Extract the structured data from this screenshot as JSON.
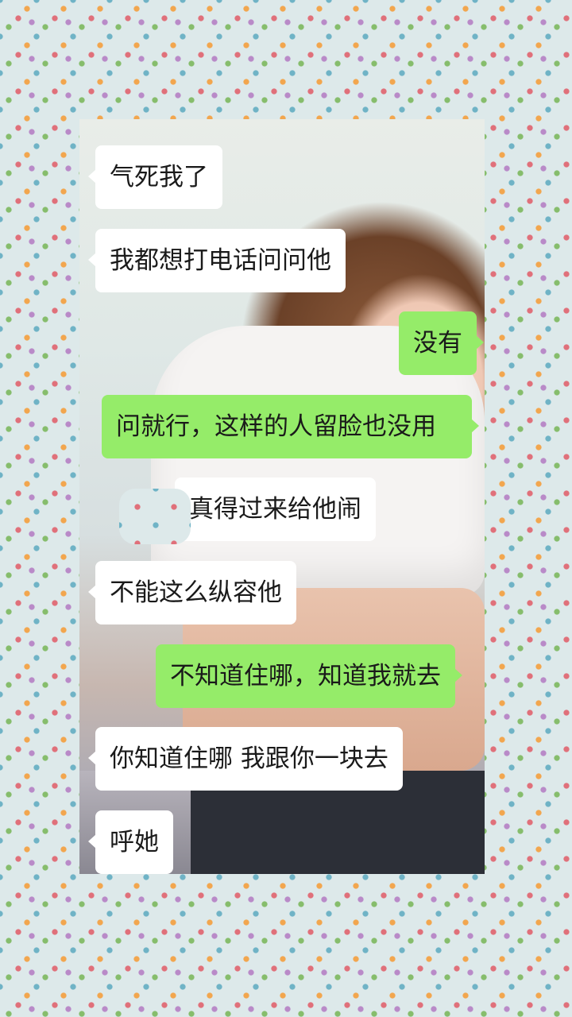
{
  "chat": {
    "messages": [
      {
        "side": "in",
        "text": "气死我了"
      },
      {
        "side": "in",
        "text": "我都想打电话问问他"
      },
      {
        "side": "out",
        "text": "没有"
      },
      {
        "side": "out",
        "text": "问就行，这样的人留脸也没用"
      },
      {
        "side": "in",
        "text": "真得过来给他闹"
      },
      {
        "side": "in",
        "text": "不能这么纵容他"
      },
      {
        "side": "out",
        "text": "不知道住哪，知道我就去"
      },
      {
        "side": "in",
        "text": "你知道住哪  我跟你一块去"
      },
      {
        "side": "in",
        "text": "呼她"
      }
    ]
  },
  "colors": {
    "incoming_bubble": "#ffffff",
    "outgoing_bubble": "#95ec69",
    "background": "#dde9ea"
  }
}
